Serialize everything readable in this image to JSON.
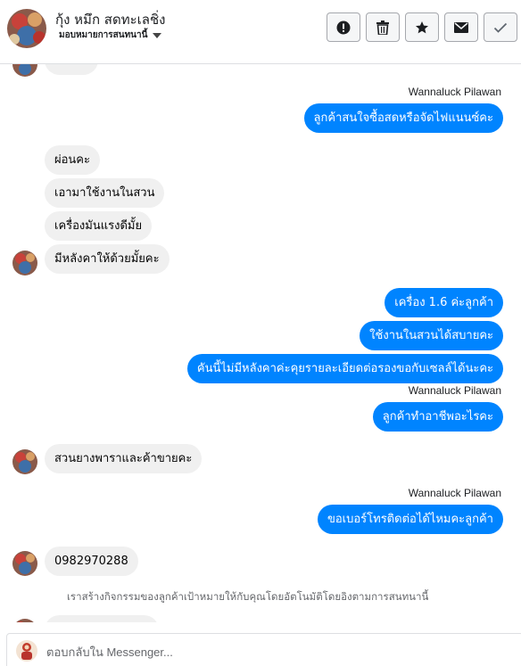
{
  "header": {
    "contact_name": "กุ้ง หมึก สดทะเลชิ่ง",
    "subtitle": "มอบหมายการสนทนานี้",
    "actions": [
      "mark-spam",
      "delete",
      "star",
      "mark-unread",
      "done"
    ]
  },
  "sender_label": "Wannaluck Pilawan",
  "messages": [
    {
      "direction": "out",
      "text": "ลูกค้าสนใจซื้อสดหรือจัดไฟแนนซ์คะ"
    },
    {
      "direction": "in",
      "text": "ผ่อนคะ"
    },
    {
      "direction": "in",
      "text": "เอามาใช้งานในสวน"
    },
    {
      "direction": "in",
      "text": "เครื่องมันแรงดีมั้ย"
    },
    {
      "direction": "in",
      "text": "มีหลังคาให้ด้วยมั้ยคะ"
    },
    {
      "direction": "out",
      "text": "เครื่อง 1.6 ค่ะลูกค้า"
    },
    {
      "direction": "out",
      "text": "ใช้งานในสวนได้สบายคะ"
    },
    {
      "direction": "out",
      "text": "คันนี้ไม่มีหลังคาค่ะคุยรายละเอียดต่อรองขอกับเซลล์ได้นะคะ"
    },
    {
      "direction": "out",
      "text": "ลูกค้าทำอาชีพอะไรคะ"
    },
    {
      "direction": "in",
      "text": "สวนยางพาราและค้าขายคะ"
    },
    {
      "direction": "out",
      "text": "ขอเบอร์โทรติดต่อได้ไหมคะลูกค้า"
    },
    {
      "direction": "in",
      "text": "0982970288"
    }
  ],
  "system_note": "เราสร้างกิจกรรมของลูกค้าเป้าหมายให้กับคุณโดยอัตโนมัติโดยอิงตามการสนทนานี้",
  "composer": {
    "placeholder": "ตอบกลับใน Messenger..."
  },
  "colors": {
    "outgoing_bubble": "#0084ff",
    "incoming_bubble": "#f0f0f0"
  }
}
